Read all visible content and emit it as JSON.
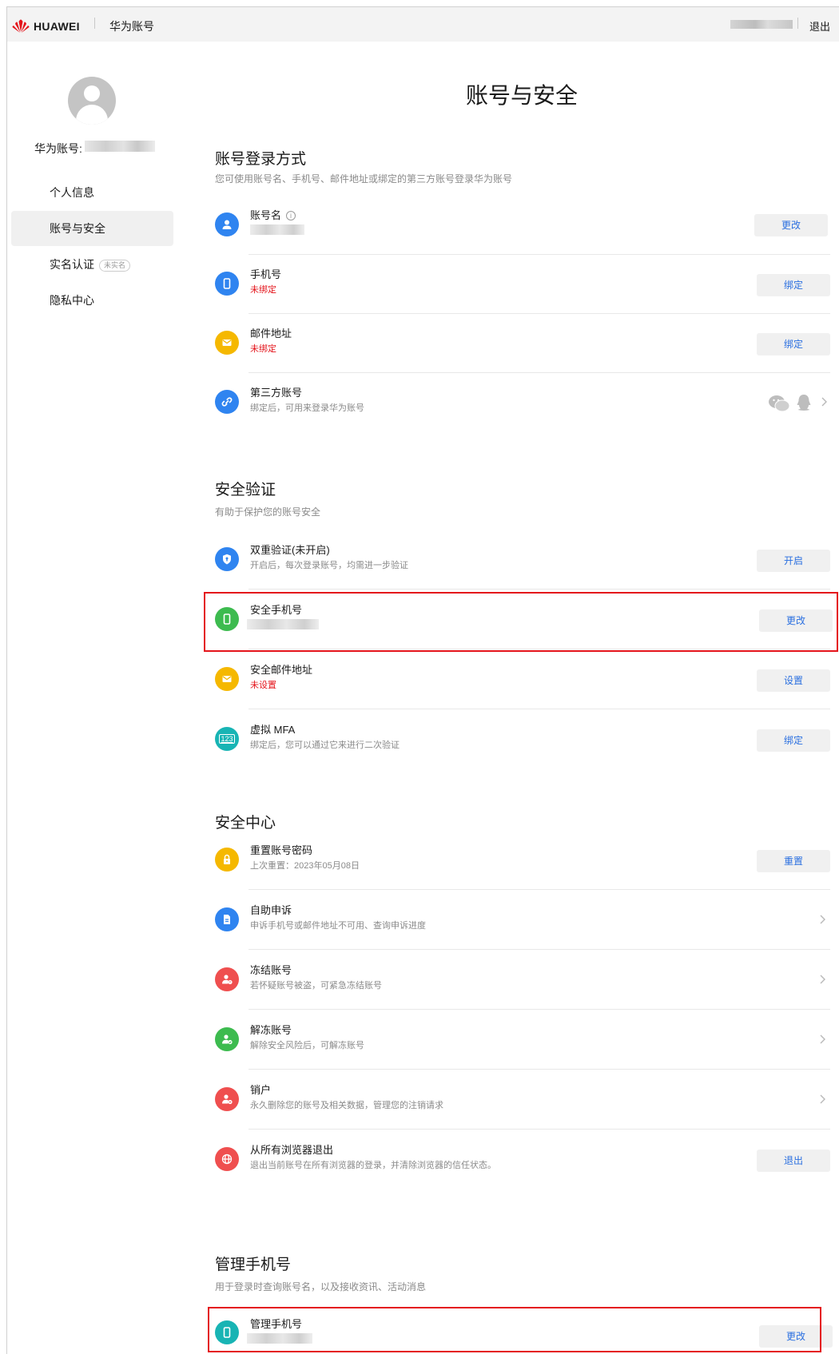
{
  "header": {
    "brand": "HUAWEI",
    "app_name": "华为账号",
    "logout": "退出",
    "brand_color": "#e4141b"
  },
  "sidebar": {
    "account_label": "华为账号:",
    "items": [
      {
        "label": "个人信息"
      },
      {
        "label": "账号与安全"
      },
      {
        "label": "实名认证",
        "badge": "未实名"
      },
      {
        "label": "隐私中心"
      }
    ]
  },
  "main": {
    "title": "账号与安全",
    "login_methods": {
      "title": "账号登录方式",
      "subtitle": "您可使用账号名、手机号、邮件地址或绑定的第三方账号登录华为账号",
      "rows": [
        {
          "icon": "user-icon",
          "title": "账号名",
          "info": "i",
          "button": "更改"
        },
        {
          "icon": "phone-icon",
          "title": "手机号",
          "sub": "未绑定",
          "button": "绑定"
        },
        {
          "icon": "mail-icon",
          "title": "邮件地址",
          "sub": "未绑定",
          "button": "绑定"
        },
        {
          "icon": "link-icon",
          "title": "第三方账号",
          "sub": "绑定后，可用来登录华为账号"
        }
      ]
    },
    "security_verification": {
      "title": "安全验证",
      "subtitle": "有助于保护您的账号安全",
      "rows": [
        {
          "icon": "shield-icon",
          "title": "双重验证(未开启)",
          "sub": "开启后，每次登录账号，均需进一步验证",
          "button": "开启"
        },
        {
          "icon": "phone-icon",
          "title": "安全手机号",
          "button": "更改"
        },
        {
          "icon": "mail-icon",
          "title": "安全邮件地址",
          "sub": "未设置",
          "button": "设置"
        },
        {
          "icon": "mfa-icon",
          "icon_text": "123",
          "title": "虚拟 MFA",
          "sub": "绑定后，您可以通过它来进行二次验证",
          "button": "绑定"
        }
      ]
    },
    "security_center": {
      "title": "安全中心",
      "rows": [
        {
          "icon": "lock-icon",
          "title": "重置账号密码",
          "sub": "上次重置：2023年05月08日",
          "button": "重置"
        },
        {
          "icon": "document-icon",
          "title": "自助申诉",
          "sub": "申诉手机号或邮件地址不可用、查询申诉进度"
        },
        {
          "icon": "freeze-icon",
          "title": "冻结账号",
          "sub": "若怀疑账号被盗，可紧急冻结账号"
        },
        {
          "icon": "unfreeze-icon",
          "title": "解冻账号",
          "sub": "解除安全风险后，可解冻账号"
        },
        {
          "icon": "delete-account-icon",
          "title": "销户",
          "sub": "永久删除您的账号及相关数据，管理您的注销请求"
        },
        {
          "icon": "globe-icon",
          "title": "从所有浏览器退出",
          "sub": "退出当前账号在所有浏览器的登录，并清除浏览器的信任状态。",
          "button": "退出"
        }
      ]
    },
    "manage_phone": {
      "title": "管理手机号",
      "subtitle": "用于登录时查询账号名，以及接收资讯、活动消息",
      "rows": [
        {
          "icon": "phone-icon",
          "title": "管理手机号",
          "button": "更改"
        }
      ]
    }
  }
}
